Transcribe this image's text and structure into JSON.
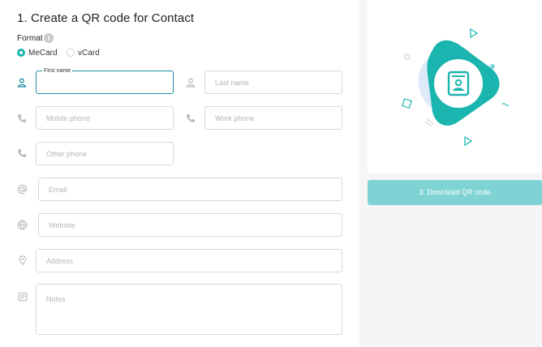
{
  "form": {
    "title": "1. Create a QR code for Contact",
    "format_label": "Format",
    "format_info": "i",
    "formats": [
      {
        "label": "MeCard",
        "selected": true
      },
      {
        "label": "vCard",
        "selected": false
      }
    ],
    "fields": {
      "first_name": {
        "label": "First name",
        "value": ""
      },
      "last_name": {
        "placeholder": "Last name"
      },
      "mobile_phone": {
        "placeholder": "Mobile phone"
      },
      "work_phone": {
        "placeholder": "Work phone"
      },
      "other_phone": {
        "placeholder": "Other phone"
      },
      "email": {
        "placeholder": "Email"
      },
      "website": {
        "placeholder": "Website"
      },
      "address": {
        "placeholder": "Address"
      },
      "notes": {
        "placeholder": "Notes"
      }
    },
    "icons": {
      "person": "person-icon",
      "phone": "phone-icon",
      "at": "at-icon",
      "globe": "globe-icon",
      "location": "location-pin-icon",
      "notes": "notes-icon"
    }
  },
  "preview": {
    "download_label": "3. Download QR code",
    "accent": "#19b5ae",
    "button_color": "#7fd3d5"
  }
}
